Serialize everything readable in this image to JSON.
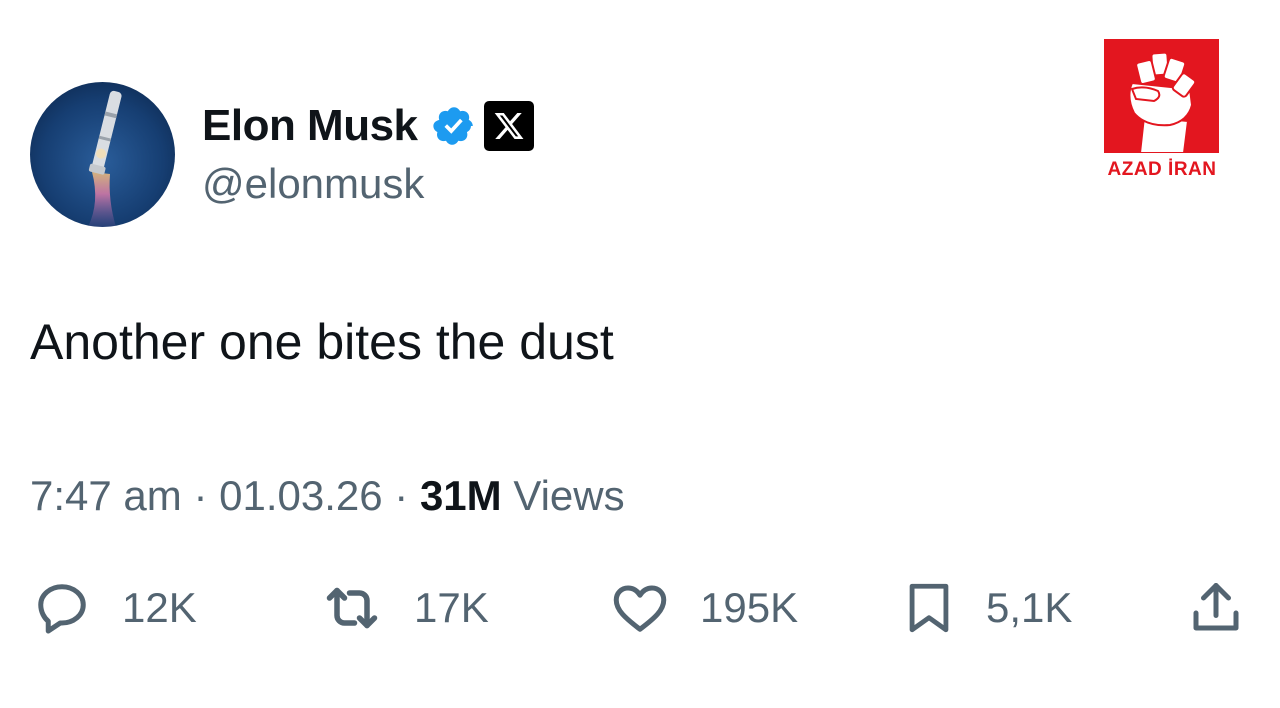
{
  "user": {
    "display_name": "Elon Musk",
    "handle": "@elonmusk",
    "verified_icon": "verified-badge-icon",
    "platform_icon": "x-logo-icon"
  },
  "watermark": {
    "text": "AZAD İRAN",
    "color": "#e3161f",
    "icon": "raised-fist-icon"
  },
  "tweet": {
    "text": "Another one bites the dust"
  },
  "meta": {
    "time": "7:47 am",
    "sep1": "·",
    "date": "01.03.26",
    "sep2": "·",
    "views_count": "31M",
    "views_label": "Views"
  },
  "actions": {
    "replies": "12K",
    "reposts": "17K",
    "likes": "195K",
    "bookmarks": "5,1K"
  },
  "colors": {
    "text": "#0f1419",
    "secondary": "#536471",
    "verified": "#1d9bf0"
  }
}
